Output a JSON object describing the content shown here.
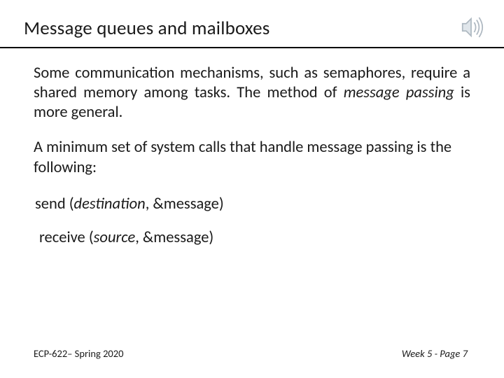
{
  "title": "Message queues and mailboxes",
  "content": {
    "p1_a": "Some communication mechanisms, such as semaphores, require a shared memory among tasks.  The method of ",
    "p1_b": "message passing",
    "p1_c": " is more general.",
    "p2": "A minimum set of system calls that handle message passing is the following:",
    "call1_a": "send (",
    "call1_b": "destination",
    "call1_c": ", &message)",
    "call2_a": "receive (",
    "call2_b": "source",
    "call2_c": ", &message)"
  },
  "footer": {
    "left": "ECP-622– Spring 2020",
    "right": "Week 5 - Page 7"
  },
  "icon": {
    "name": "audio-speaker-icon"
  }
}
